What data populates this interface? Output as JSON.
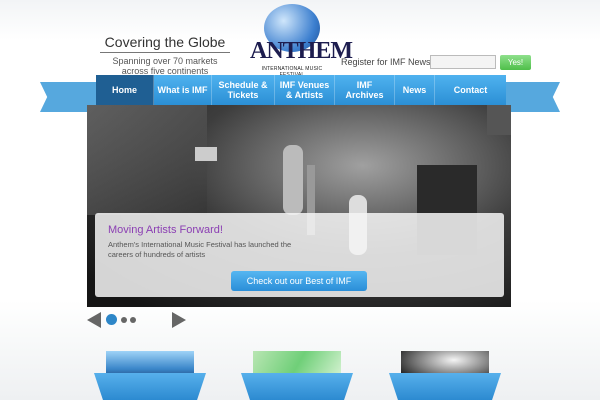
{
  "header": {
    "tagline_title": "Covering the Globe",
    "tagline_sub": "Spanning over 70 markets across five continents",
    "logo_text": "ANTHEM",
    "logo_sub": "INTERNATIONAL MUSIC FESTIVAL",
    "register_label": "Register for IMF News:",
    "register_placeholder": "",
    "register_button": "Yes!"
  },
  "nav": {
    "items": [
      {
        "label": "Home",
        "active": true
      },
      {
        "label": "What is IMF",
        "active": false
      },
      {
        "label": "Schedule & Tickets",
        "active": false
      },
      {
        "label": "IMF Venues & Artists",
        "active": false
      },
      {
        "label": "IMF Archives",
        "active": false
      },
      {
        "label": "News",
        "active": false
      },
      {
        "label": "Contact",
        "active": false
      }
    ]
  },
  "slider": {
    "caption_title": "Moving Artists Forward!",
    "caption_text": "Anthem's International Music Festival has launched the careers of hundreds of artists",
    "cta_label": "Check out our Best of IMF",
    "active_slide": 1,
    "slide_count": 3
  },
  "colors": {
    "nav_blue": "#2b8fd5",
    "nav_active": "#1f5f93",
    "accent_purple": "#8b3fb3",
    "button_green": "#4fbf4a"
  }
}
